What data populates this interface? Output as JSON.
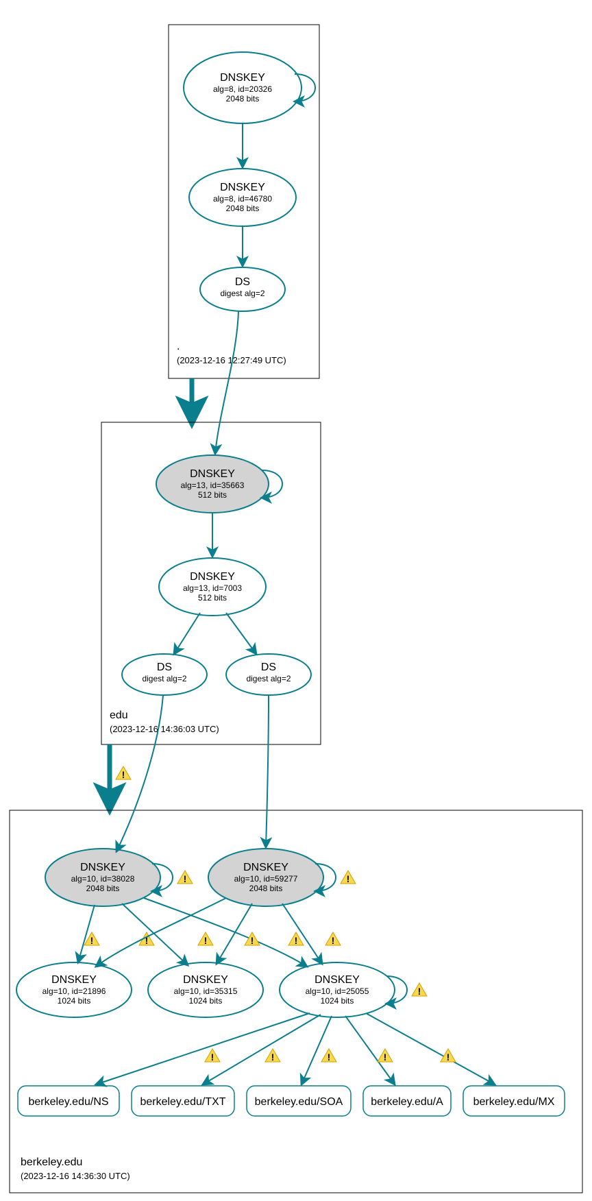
{
  "zones": {
    "root": {
      "name": ".",
      "timestamp": "(2023-12-16 12:27:49 UTC)",
      "ksk": {
        "title": "DNSKEY",
        "detail": "alg=8, id=20326",
        "bits": "2048 bits"
      },
      "zsk": {
        "title": "DNSKEY",
        "detail": "alg=8, id=46780",
        "bits": "2048 bits"
      },
      "ds": {
        "title": "DS",
        "detail": "digest alg=2"
      }
    },
    "edu": {
      "name": "edu",
      "timestamp": "(2023-12-16 14:36:03 UTC)",
      "ksk": {
        "title": "DNSKEY",
        "detail": "alg=13, id=35663",
        "bits": "512 bits"
      },
      "zsk": {
        "title": "DNSKEY",
        "detail": "alg=13, id=7003",
        "bits": "512 bits"
      },
      "ds1": {
        "title": "DS",
        "detail": "digest alg=2"
      },
      "ds2": {
        "title": "DS",
        "detail": "digest alg=2"
      }
    },
    "berkeley": {
      "name": "berkeley.edu",
      "timestamp": "(2023-12-16 14:36:30 UTC)",
      "ksk1": {
        "title": "DNSKEY",
        "detail": "alg=10, id=38028",
        "bits": "2048 bits"
      },
      "ksk2": {
        "title": "DNSKEY",
        "detail": "alg=10, id=59277",
        "bits": "2048 bits"
      },
      "zsk1": {
        "title": "DNSKEY",
        "detail": "alg=10, id=21896",
        "bits": "1024 bits"
      },
      "zsk2": {
        "title": "DNSKEY",
        "detail": "alg=10, id=35315",
        "bits": "1024 bits"
      },
      "zsk3": {
        "title": "DNSKEY",
        "detail": "alg=10, id=25055",
        "bits": "1024 bits"
      },
      "rrsets": {
        "ns": "berkeley.edu/NS",
        "txt": "berkeley.edu/TXT",
        "soa": "berkeley.edu/SOA",
        "a": "berkeley.edu/A",
        "mx": "berkeley.edu/MX"
      }
    }
  }
}
